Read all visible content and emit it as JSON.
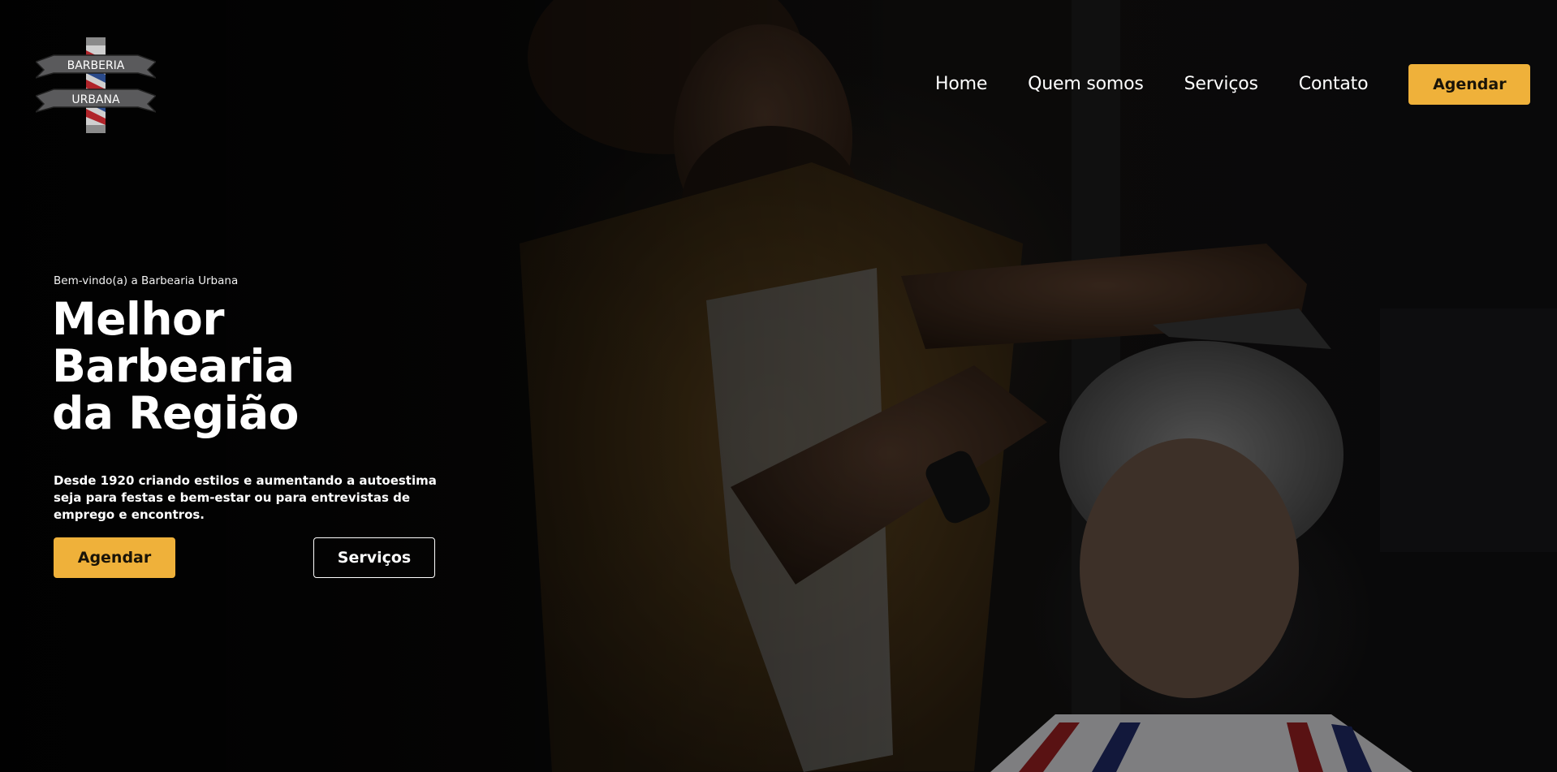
{
  "brand": {
    "logo_text_top": "BARBERIA",
    "logo_text_bottom": "URBANA",
    "accent_color": "#efb13a"
  },
  "nav": {
    "links": [
      "Home",
      "Quem somos",
      "Serviços",
      "Contato"
    ],
    "cta_label": "Agendar"
  },
  "hero": {
    "welcome": "Bem-vindo(a) a Barbearia Urbana",
    "headline_lines": [
      "Melhor",
      "Barbearia",
      "da Região"
    ],
    "description": "Desde 1920 criando estilos e aumentando a autoestima seja para festas e bem-estar ou para entrevistas de emprego e encontros.",
    "primary_button": "Agendar",
    "secondary_button": "Serviços",
    "background_image": "barber-cutting-hair-photo"
  }
}
